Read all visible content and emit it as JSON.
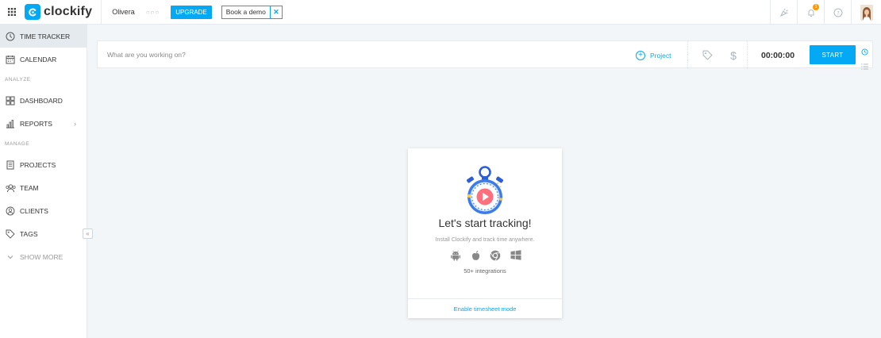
{
  "app": {
    "name": "clockify"
  },
  "topbar": {
    "workspace": "Olivera",
    "upgrade_label": "UPGRADE",
    "demo_label": "Book a demo",
    "notification_count": "1"
  },
  "sidebar": {
    "items": [
      {
        "label": "TIME TRACKER",
        "icon": "clock-icon"
      },
      {
        "label": "CALENDAR",
        "icon": "calendar-icon"
      }
    ],
    "analyze_heading": "ANALYZE",
    "analyze_items": [
      {
        "label": "DASHBOARD",
        "icon": "dashboard-icon"
      },
      {
        "label": "REPORTS",
        "icon": "bar-chart-icon"
      }
    ],
    "manage_heading": "MANAGE",
    "manage_items": [
      {
        "label": "PROJECTS",
        "icon": "document-icon"
      },
      {
        "label": "TEAM",
        "icon": "team-icon"
      },
      {
        "label": "CLIENTS",
        "icon": "client-icon"
      },
      {
        "label": "TAGS",
        "icon": "tag-icon"
      }
    ],
    "show_more_label": "SHOW MORE"
  },
  "tracker": {
    "placeholder": "What are you working on?",
    "project_label": "Project",
    "timer": "00:00:00",
    "start_label": "START"
  },
  "empty_state": {
    "title": "Let's start tracking!",
    "subtitle": "Install Clockify and track time anywhere.",
    "integrations": "50+ integrations",
    "timesheet_link": "Enable timesheet mode"
  },
  "colors": {
    "accent": "#03a9f4",
    "badge": "#ff9800",
    "background": "#f2f6f8",
    "active_nav": "#e4eaee"
  }
}
